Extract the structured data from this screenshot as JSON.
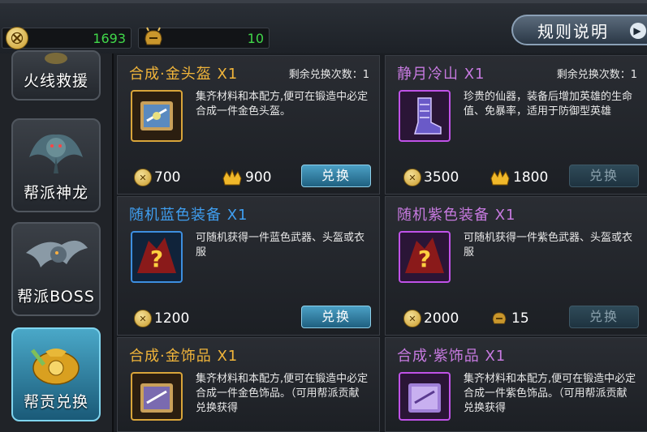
{
  "resources": {
    "coin_value": "1693",
    "helm_value": "10"
  },
  "header": {
    "rules_label": "规则说明"
  },
  "sidebar": {
    "items": [
      {
        "label": "火线救援",
        "active": false
      },
      {
        "label": "帮派神龙",
        "active": false
      },
      {
        "label": "帮派BOSS",
        "active": false
      },
      {
        "label": "帮贡兑换",
        "active": true
      }
    ]
  },
  "cards": [
    {
      "title": "合成·金头盔 X1",
      "title_color": "#f0b43a",
      "remain": "剩余兑换次数：1",
      "desc": "集齐材料和本配方,便可在锻造中必定合成一件金色头盔。",
      "cost1": "700",
      "cost2": "900",
      "button": "兑换",
      "button_enabled": true,
      "icon": "gold-scroll-icon"
    },
    {
      "title": "静月冷山 X1",
      "title_color": "#c77ae0",
      "remain": "剩余兑换次数：1",
      "desc": "珍贵的仙器，装备后增加英雄的生命值、免暴率，适用于防御型英雄",
      "cost1": "3500",
      "cost2": "1800",
      "button": "兑换",
      "button_enabled": false,
      "icon": "purple-boot-icon"
    },
    {
      "title": "随机蓝色装备 X1",
      "title_color": "#3f9ef0",
      "remain": "",
      "desc": "可随机获得一件蓝色武器、头盔或衣服",
      "cost1": "1200",
      "cost2": "",
      "button": "兑换",
      "button_enabled": true,
      "icon": "mystery-blue-icon"
    },
    {
      "title": "随机紫色装备 X1",
      "title_color": "#c77ae0",
      "remain": "",
      "desc": "可随机获得一件紫色武器、头盔或衣服",
      "cost1": "2000",
      "cost2": "15",
      "button": "兑换",
      "button_enabled": false,
      "icon": "mystery-purple-icon"
    },
    {
      "title": "合成·金饰品 X1",
      "title_color": "#f0b43a",
      "remain": "",
      "desc": "集齐材料和本配方,便可在锻造中必定合成一件金色饰品。（可用帮派贡献兑换获得",
      "icon": "gold-scroll-icon"
    },
    {
      "title": "合成·紫饰品 X1",
      "title_color": "#c77ae0",
      "remain": "",
      "desc": "集齐材料和本配方,便可在锻造中必定合成一件紫色饰品。（可用帮派贡献兑换获得",
      "icon": "purple-scroll-icon"
    }
  ]
}
